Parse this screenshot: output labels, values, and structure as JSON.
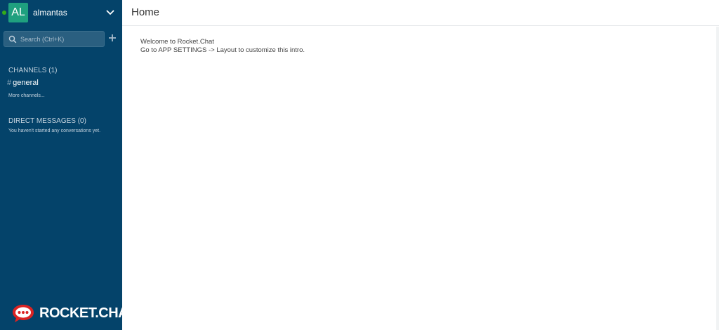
{
  "user": {
    "initials": "AL",
    "name": "almantas",
    "status_color": "#35ac19"
  },
  "search": {
    "placeholder": "Search (Ctrl+K)"
  },
  "channels": {
    "title": "CHANNELS (1)",
    "items": [
      {
        "label": "general",
        "icon": "hash-icon"
      }
    ],
    "more_link": "More channels..."
  },
  "direct_messages": {
    "title": "DIRECT MESSAGES (0)",
    "empty_text": "You haven't started any conversations yet."
  },
  "logo": {
    "text": "ROCKET.CHAT"
  },
  "main": {
    "title": "Home",
    "intro_line1": "Welcome to Rocket.Chat",
    "intro_line2": "Go to APP SETTINGS -> Layout to customize this intro."
  },
  "colors": {
    "sidebar_bg": "#04436a",
    "avatar_bg": "#1fa07f",
    "logo_red": "#db2323"
  }
}
